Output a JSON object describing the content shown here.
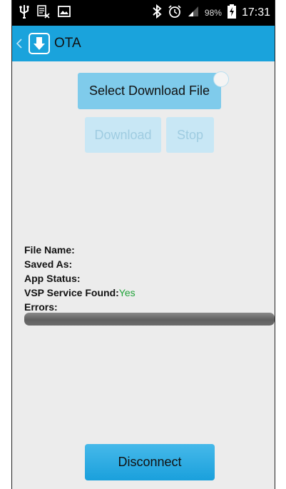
{
  "status_bar": {
    "battery_percent": "98%",
    "time": "17:31",
    "icons": [
      "usb-icon",
      "notification-icon",
      "image-icon",
      "bluetooth-icon",
      "alarm-icon",
      "signal-icon",
      "battery-charging-icon"
    ]
  },
  "action_bar": {
    "title": "OTA",
    "background_color": "#1aa3dc"
  },
  "buttons": {
    "select_file": "Select Download File",
    "download": "Download",
    "stop": "Stop",
    "disconnect": "Disconnect"
  },
  "info": {
    "file_name_label": "File Name:",
    "saved_as_label": "Saved As:",
    "app_status_label": "App Status:",
    "vsp_label": "VSP Service Found:",
    "vsp_value": "Yes",
    "errors_label": "Errors:"
  },
  "progress": {
    "value": 0
  }
}
